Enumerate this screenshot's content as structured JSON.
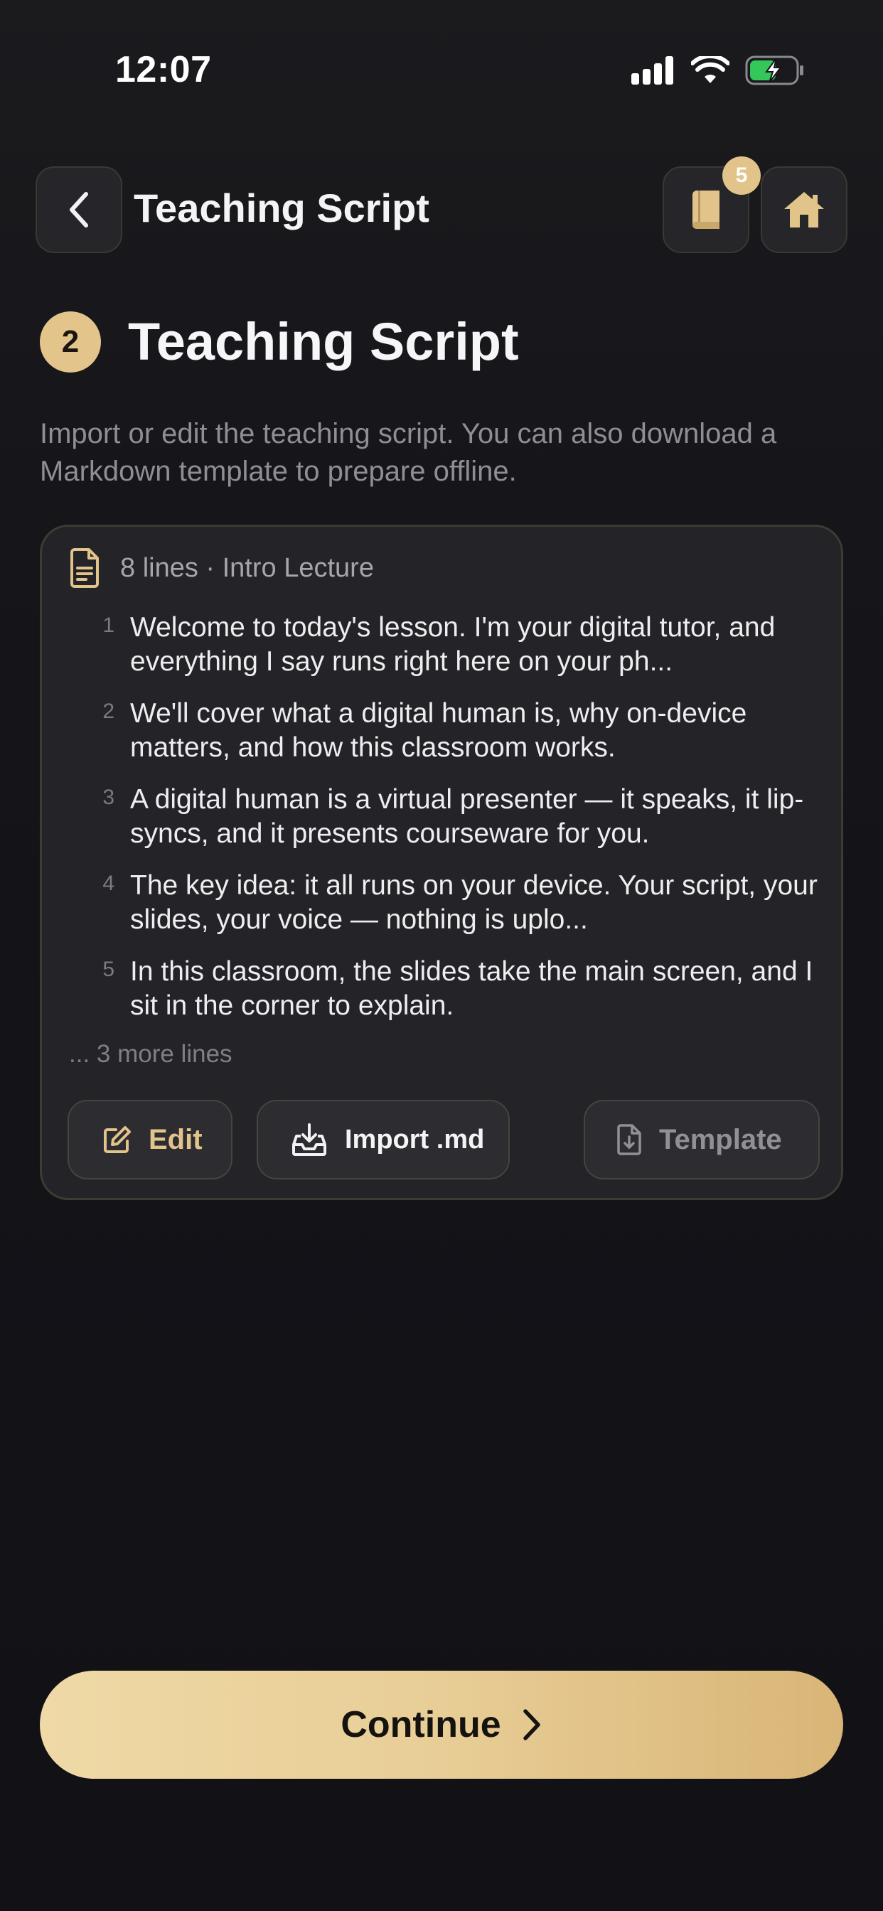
{
  "status_bar": {
    "time": "12:07"
  },
  "nav": {
    "title": "Teaching Script",
    "courses_badge": "5"
  },
  "header": {
    "step_number": "2",
    "title": "Teaching Script",
    "description": "Import or edit the teaching script. You can also download a Markdown template to prepare offline."
  },
  "script": {
    "meta": "8 lines · Intro Lecture",
    "lines": [
      {
        "number": "1",
        "text": "Welcome to today's lesson. I'm your digital tutor, and everything I say runs right here on your ph..."
      },
      {
        "number": "2",
        "text": "We'll cover what a digital human is, why on-device matters, and how this classroom works."
      },
      {
        "number": "3",
        "text": "A digital human is a virtual presenter — it speaks, it lip-syncs, and it presents courseware for you."
      },
      {
        "number": "4",
        "text": "The key idea: it all runs on your device. Your script, your slides, your voice — nothing is uplo..."
      },
      {
        "number": "5",
        "text": "In this classroom, the slides take the main screen, and I sit in the corner to explain."
      }
    ],
    "more_lines": "... 3 more lines",
    "actions": {
      "edit_label": "Edit",
      "import_label": "Import .md",
      "template_label": "Template"
    }
  },
  "footer": {
    "continue_label": "Continue"
  },
  "colors": {
    "accent": "#e2c389",
    "background": "#121218",
    "card": "#232328"
  }
}
